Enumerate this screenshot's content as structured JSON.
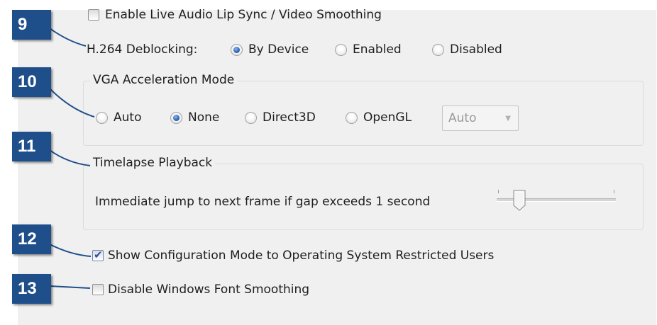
{
  "checkboxes": {
    "live_audio": {
      "label": "Enable Live Audio Lip Sync / Video Smoothing",
      "checked": false
    },
    "show_config": {
      "label": "Show Configuration Mode to Operating System Restricted Users",
      "checked": true
    },
    "disable_font_smoothing": {
      "label": "Disable Windows Font Smoothing",
      "checked": false
    }
  },
  "h264": {
    "label": "H.264 Deblocking:",
    "options": [
      "By Device",
      "Enabled",
      "Disabled"
    ],
    "selected": "By Device"
  },
  "vga": {
    "title": "VGA Acceleration Mode",
    "options": [
      "Auto",
      "None",
      "Direct3D",
      "OpenGL"
    ],
    "selected": "None",
    "dropdown_value": "Auto"
  },
  "timelapse": {
    "title": "Timelapse Playback",
    "label": "Immediate jump to next frame if gap exceeds 1 second",
    "slider_value": 0.15
  },
  "badges": [
    "9",
    "10",
    "11",
    "12",
    "13"
  ],
  "colors": {
    "badge": "#1f4f8b",
    "radio_selected": "#2b63b8",
    "panel": "#f0f0f0"
  }
}
